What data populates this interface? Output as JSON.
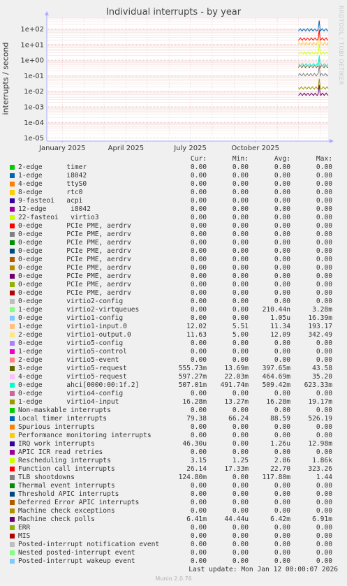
{
  "chart_data": {
    "type": "line",
    "title": "Individual interrupts - by year",
    "ylabel": "interrupts / second",
    "y_scale": "log",
    "y_ticks": [
      "1e-05",
      "1e-04",
      "1e-03",
      "1e-02",
      "1e-01",
      "1e+00",
      "1e+01",
      "1e+02"
    ],
    "x_ticks": [
      "January 2025",
      "April 2025",
      "July 2025",
      "October 2025"
    ],
    "x_tick_dates": [
      "2025-01-01",
      "2025-04-01",
      "2025-07-01",
      "2025-10-01"
    ],
    "x_range": [
      "2024-12-10",
      "2026-01-12"
    ],
    "data_start": "2025-12-01",
    "grid": true,
    "columns": [
      "Cur:",
      "Min:",
      "Avg:",
      "Max:"
    ],
    "series": [
      {
        "label": "2-edge      timer",
        "color": "#00cc00",
        "cur": "0.00",
        "min": "0.00",
        "avg": "0.00",
        "max": "0.00"
      },
      {
        "label": "1-edge      i8042",
        "color": "#0066b3",
        "cur": "0.00",
        "min": "0.00",
        "avg": "0.00",
        "max": "0.00"
      },
      {
        "label": "4-edge      ttyS0",
        "color": "#ff8000",
        "cur": "0.00",
        "min": "0.00",
        "avg": "0.00",
        "max": "0.00"
      },
      {
        "label": "8-edge      rtc0",
        "color": "#ffcc00",
        "cur": "0.00",
        "min": "0.00",
        "avg": "0.00",
        "max": "0.00"
      },
      {
        "label": "9-fasteoi   acpi",
        "color": "#330099",
        "cur": "0.00",
        "min": "0.00",
        "avg": "0.00",
        "max": "0.00"
      },
      {
        "label": "12-edge      i8042",
        "color": "#990099",
        "cur": "0.00",
        "min": "0.00",
        "avg": "0.00",
        "max": "0.00"
      },
      {
        "label": "22-fasteoi   virtio3",
        "color": "#ccff00",
        "cur": "0.00",
        "min": "0.00",
        "avg": "0.00",
        "max": "0.00"
      },
      {
        "label": "0-edge      PCIe PME, aerdrv",
        "color": "#ff0000",
        "cur": "0.00",
        "min": "0.00",
        "avg": "0.00",
        "max": "0.00"
      },
      {
        "label": "0-edge      PCIe PME, aerdrv",
        "color": "#808080",
        "cur": "0.00",
        "min": "0.00",
        "avg": "0.00",
        "max": "0.00"
      },
      {
        "label": "0-edge      PCIe PME, aerdrv",
        "color": "#008f00",
        "cur": "0.00",
        "min": "0.00",
        "avg": "0.00",
        "max": "0.00"
      },
      {
        "label": "0-edge      PCIe PME, aerdrv",
        "color": "#00487d",
        "cur": "0.00",
        "min": "0.00",
        "avg": "0.00",
        "max": "0.00"
      },
      {
        "label": "0-edge      PCIe PME, aerdrv",
        "color": "#b35a00",
        "cur": "0.00",
        "min": "0.00",
        "avg": "0.00",
        "max": "0.00"
      },
      {
        "label": "0-edge      PCIe PME, aerdrv",
        "color": "#b38f00",
        "cur": "0.00",
        "min": "0.00",
        "avg": "0.00",
        "max": "0.00"
      },
      {
        "label": "0-edge      PCIe PME, aerdrv",
        "color": "#6b006b",
        "cur": "0.00",
        "min": "0.00",
        "avg": "0.00",
        "max": "0.00"
      },
      {
        "label": "0-edge      PCIe PME, aerdrv",
        "color": "#8fb300",
        "cur": "0.00",
        "min": "0.00",
        "avg": "0.00",
        "max": "0.00"
      },
      {
        "label": "0-edge      PCIe PME, aerdrv",
        "color": "#b30000",
        "cur": "0.00",
        "min": "0.00",
        "avg": "0.00",
        "max": "0.00"
      },
      {
        "label": "0-edge      virtio2-config",
        "color": "#bebebe",
        "cur": "0.00",
        "min": "0.00",
        "avg": "0.00",
        "max": "0.00"
      },
      {
        "label": "1-edge      virtio2-virtqueues",
        "color": "#80ff80",
        "cur": "0.00",
        "min": "0.00",
        "avg": "210.44n",
        "max": "3.28m"
      },
      {
        "label": "0-edge      virtio1-config",
        "color": "#80c9ff",
        "cur": "0.00",
        "min": "0.00",
        "avg": "1.05u",
        "max": "16.39m"
      },
      {
        "label": "1-edge      virtio1-input.0",
        "color": "#ffc080",
        "cur": "12.02",
        "min": "5.51",
        "avg": "11.34",
        "max": "193.17"
      },
      {
        "label": "2-edge      virtio1-output.0",
        "color": "#ffe680",
        "cur": "11.63",
        "min": "5.00",
        "avg": "12.09",
        "max": "342.49"
      },
      {
        "label": "0-edge      virtio5-config",
        "color": "#aa80ff",
        "cur": "0.00",
        "min": "0.00",
        "avg": "0.00",
        "max": "0.00"
      },
      {
        "label": "1-edge      virtio5-control",
        "color": "#ee00cc",
        "cur": "0.00",
        "min": "0.00",
        "avg": "0.00",
        "max": "0.00"
      },
      {
        "label": "2-edge      virtio5-event",
        "color": "#ff8080",
        "cur": "0.00",
        "min": "0.00",
        "avg": "0.00",
        "max": "0.00"
      },
      {
        "label": "3-edge      virtio5-request",
        "color": "#666600",
        "cur": "555.73m",
        "min": "13.69m",
        "avg": "397.65m",
        "max": "43.58"
      },
      {
        "label": "4-edge      virtio5-request",
        "color": "#ffbfff",
        "cur": "597.27m",
        "min": "22.03m",
        "avg": "464.69m",
        "max": "35.20"
      },
      {
        "label": "0-edge      ahci[0000:00:1f.2]",
        "color": "#00ffcc",
        "cur": "507.01m",
        "min": "491.74m",
        "avg": "509.42m",
        "max": "623.33m"
      },
      {
        "label": "0-edge      virtio4-config",
        "color": "#cc6699",
        "cur": "0.00",
        "min": "0.00",
        "avg": "0.00",
        "max": "0.00"
      },
      {
        "label": "1-edge      virtio4-input",
        "color": "#999900",
        "cur": "16.28m",
        "min": "13.27m",
        "avg": "16.28m",
        "max": "19.17m"
      },
      {
        "label": "Non-maskable interrupts",
        "color": "#00cc00",
        "cur": "0.00",
        "min": "0.00",
        "avg": "0.00",
        "max": "0.00"
      },
      {
        "label": "Local timer interrupts",
        "color": "#0066b3",
        "cur": "79.38",
        "min": "66.24",
        "avg": "88.59",
        "max": "526.19"
      },
      {
        "label": "Spurious interrupts",
        "color": "#ff8000",
        "cur": "0.00",
        "min": "0.00",
        "avg": "0.00",
        "max": "0.00"
      },
      {
        "label": "Performance monitoring interrupts",
        "color": "#ffcc00",
        "cur": "0.00",
        "min": "0.00",
        "avg": "0.00",
        "max": "0.00"
      },
      {
        "label": "IRQ work interrupts",
        "color": "#330099",
        "cur": "46.30u",
        "min": "0.00",
        "avg": "1.26u",
        "max": "12.98m"
      },
      {
        "label": "APIC ICR read retries",
        "color": "#990099",
        "cur": "0.00",
        "min": "0.00",
        "avg": "0.00",
        "max": "0.00"
      },
      {
        "label": "Rescheduling interrupts",
        "color": "#ccff00",
        "cur": "3.15",
        "min": "1.25",
        "avg": "2.86",
        "max": "1.86k"
      },
      {
        "label": "Function call interrupts",
        "color": "#ff0000",
        "cur": "26.14",
        "min": "17.33m",
        "avg": "22.70",
        "max": "323.26"
      },
      {
        "label": "TLB shootdowns",
        "color": "#808080",
        "cur": "124.80m",
        "min": "0.00",
        "avg": "117.80m",
        "max": "1.44"
      },
      {
        "label": "Thermal event interrupts",
        "color": "#008f00",
        "cur": "0.00",
        "min": "0.00",
        "avg": "0.00",
        "max": "0.00"
      },
      {
        "label": "Threshold APIC interrupts",
        "color": "#00487d",
        "cur": "0.00",
        "min": "0.00",
        "avg": "0.00",
        "max": "0.00"
      },
      {
        "label": "Deferred Error APIC interrupts",
        "color": "#b35a00",
        "cur": "0.00",
        "min": "0.00",
        "avg": "0.00",
        "max": "0.00"
      },
      {
        "label": "Machine check exceptions",
        "color": "#b38f00",
        "cur": "0.00",
        "min": "0.00",
        "avg": "0.00",
        "max": "0.00"
      },
      {
        "label": "Machine check polls",
        "color": "#6b006b",
        "cur": "6.41m",
        "min": "44.44u",
        "avg": "6.42m",
        "max": "6.91m"
      },
      {
        "label": "ERR",
        "color": "#8fb300",
        "cur": "0.00",
        "min": "0.00",
        "avg": "0.00",
        "max": "0.00"
      },
      {
        "label": "MIS",
        "color": "#b30000",
        "cur": "0.00",
        "min": "0.00",
        "avg": "0.00",
        "max": "0.00"
      },
      {
        "label": "Posted-interrupt notification event",
        "color": "#bebebe",
        "cur": "0.00",
        "min": "0.00",
        "avg": "0.00",
        "max": "0.00"
      },
      {
        "label": "Nested posted-interrupt event",
        "color": "#80ff80",
        "cur": "0.00",
        "min": "0.00",
        "avg": "0.00",
        "max": "0.00"
      },
      {
        "label": "Posted-interrupt wakeup event",
        "color": "#80c9ff",
        "cur": "0.00",
        "min": "0.00",
        "avg": "0.00",
        "max": "0.00"
      }
    ]
  },
  "side_credit": "RRDTOOL / TOBI OETIKER",
  "last_update": "Last update:  Mon Jan 12 00:00:07 2026",
  "footer_version": "Munin 2.0.76"
}
